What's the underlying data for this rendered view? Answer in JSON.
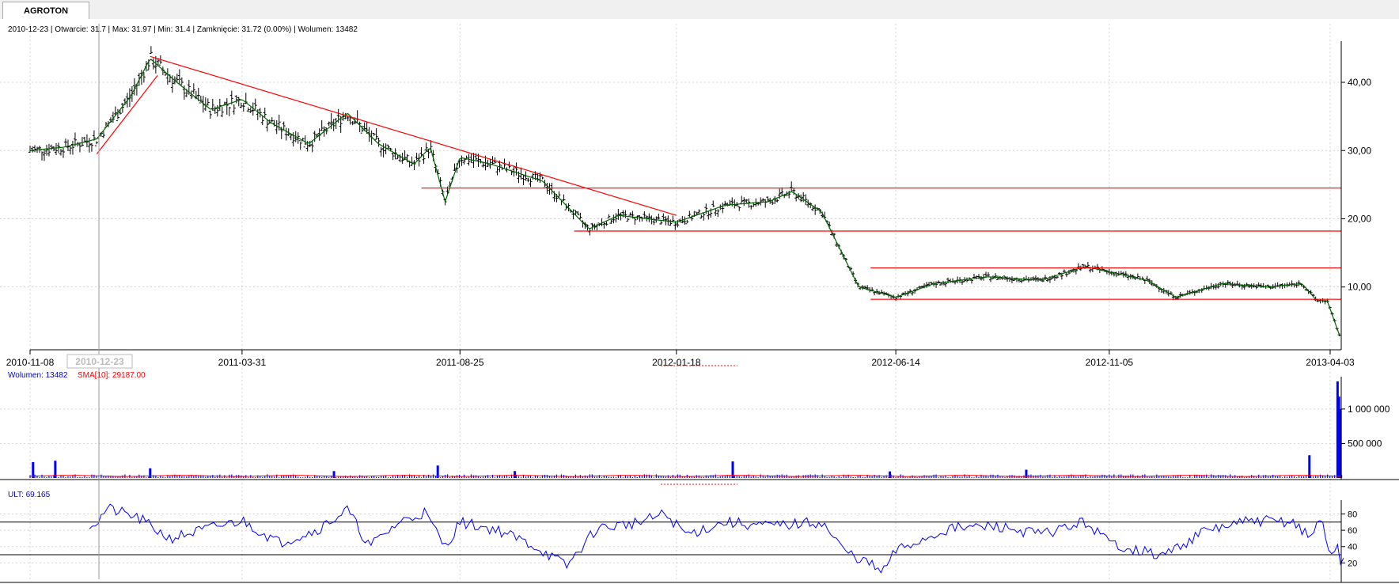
{
  "tab": {
    "label": "AGROTON"
  },
  "info_line": "2010-12-23 | Otwarcie: 31.7 | Max: 31.97 | Min: 31.4 | Zamknięcie: 31.72 (0.00%)  | Wolumen: 13482",
  "cursor_date": "2010-12-23",
  "volume_legend": {
    "wolumen": "Wolumen: 13482",
    "sma": "SMA[10]: 29187.00"
  },
  "ult_legend": "ULT: 69.165",
  "colors": {
    "price_bar": "#000000",
    "sma": "#006400",
    "trend": "#ff0000",
    "volume": "#0000ff",
    "volume_sma": "#ff0000",
    "ult": "#0000ff"
  },
  "chart_data": [
    {
      "type": "bar",
      "name": "price",
      "x_ticks": [
        "2010-11-08",
        "2011-03-31",
        "2011-08-25",
        "2012-01-18",
        "2012-06-14",
        "2012-11-05",
        "2013-04-03"
      ],
      "y_ticks": [
        "10,00",
        "20,00",
        "30,00",
        "40,00"
      ],
      "ylim": [
        0.8,
        46.5
      ],
      "grid": true,
      "close_path": [
        [
          "2010-11-08",
          30.0
        ],
        [
          "2010-12-01",
          30.5
        ],
        [
          "2010-12-23",
          31.7
        ],
        [
          "2011-01-15",
          38.0
        ],
        [
          "2011-01-28",
          43.5
        ],
        [
          "2011-02-15",
          40.0
        ],
        [
          "2011-03-10",
          36.0
        ],
        [
          "2011-03-31",
          37.5
        ],
        [
          "2011-04-20",
          34.0
        ],
        [
          "2011-05-15",
          31.0
        ],
        [
          "2011-06-10",
          35.5
        ],
        [
          "2011-07-01",
          31.0
        ],
        [
          "2011-07-25",
          28.0
        ],
        [
          "2011-08-05",
          30.5
        ],
        [
          "2011-08-15",
          22.5
        ],
        [
          "2011-08-25",
          29.0
        ],
        [
          "2011-09-15",
          28.0
        ],
        [
          "2011-10-20",
          25.5
        ],
        [
          "2011-11-20",
          18.5
        ],
        [
          "2011-12-10",
          20.5
        ],
        [
          "2012-01-18",
          19.5
        ],
        [
          "2012-02-20",
          22.0
        ],
        [
          "2012-03-20",
          22.5
        ],
        [
          "2012-04-05",
          24.0
        ],
        [
          "2012-04-25",
          21.0
        ],
        [
          "2012-05-20",
          10.0
        ],
        [
          "2012-06-14",
          8.5
        ],
        [
          "2012-07-10",
          10.5
        ],
        [
          "2012-08-15",
          11.5
        ],
        [
          "2012-09-20",
          11.0
        ],
        [
          "2012-10-20",
          13.0
        ],
        [
          "2012-11-30",
          11.0
        ],
        [
          "2012-12-20",
          8.5
        ],
        [
          "2013-01-20",
          10.5
        ],
        [
          "2013-02-20",
          10.0
        ],
        [
          "2013-03-15",
          10.5
        ],
        [
          "2013-03-25",
          8.0
        ],
        [
          "2013-04-01",
          8.0
        ],
        [
          "2013-04-10",
          2.5
        ]
      ],
      "trend_lines": [
        {
          "from": [
            "2010-12-23",
            29.5
          ],
          "to": [
            "2011-02-02",
            41.0
          ]
        },
        {
          "from": [
            "2011-01-28",
            43.8
          ],
          "to": [
            "2012-01-18",
            20.5
          ]
        },
        {
          "from": [
            "2011-07-30",
            24.5
          ],
          "to": [
            "2013-04-12",
            24.5
          ]
        },
        {
          "from": [
            "2011-11-10",
            18.2
          ],
          "to": [
            "2013-04-12",
            18.2
          ]
        },
        {
          "from": [
            "2012-05-28",
            12.8
          ],
          "to": [
            "2013-04-12",
            12.8
          ]
        },
        {
          "from": [
            "2012-05-28",
            8.2
          ],
          "to": [
            "2013-04-12",
            8.2
          ]
        }
      ]
    },
    {
      "type": "bar",
      "name": "volume",
      "series": [
        {
          "name": "Wolumen"
        },
        {
          "name": "SMA[10]"
        }
      ],
      "y_ticks": [
        "500 000",
        "1 000 000"
      ],
      "ylim": [
        0,
        1400000
      ],
      "spikes": [
        [
          "2010-11-10",
          230000
        ],
        [
          "2010-11-25",
          250000
        ],
        [
          "2011-01-28",
          140000
        ],
        [
          "2011-06-01",
          100000
        ],
        [
          "2011-08-10",
          180000
        ],
        [
          "2011-10-01",
          100000
        ],
        [
          "2012-02-25",
          240000
        ],
        [
          "2012-06-10",
          95000
        ],
        [
          "2012-09-10",
          120000
        ],
        [
          "2013-03-20",
          330000
        ],
        [
          "2013-04-08",
          1400000
        ],
        [
          "2013-04-09",
          1180000
        ],
        [
          "2013-04-10",
          1000000
        ]
      ]
    },
    {
      "type": "line",
      "name": "ULT",
      "series": [
        {
          "name": "ULT"
        }
      ],
      "y_ticks": [
        "20",
        "40",
        "60",
        "80"
      ],
      "ylim": [
        0,
        95
      ],
      "levels": [
        30,
        70
      ],
      "path": [
        [
          "2010-12-18",
          68
        ],
        [
          "2010-12-23",
          69
        ],
        [
          "2010-12-30",
          87
        ],
        [
          "2011-01-20",
          75
        ],
        [
          "2011-02-10",
          50
        ],
        [
          "2011-03-15",
          65
        ],
        [
          "2011-03-31",
          72
        ],
        [
          "2011-04-25",
          45
        ],
        [
          "2011-05-20",
          60
        ],
        [
          "2011-06-10",
          85
        ],
        [
          "2011-06-25",
          40
        ],
        [
          "2011-07-15",
          70
        ],
        [
          "2011-08-01",
          82
        ],
        [
          "2011-08-15",
          40
        ],
        [
          "2011-08-25",
          70
        ],
        [
          "2011-09-20",
          60
        ],
        [
          "2011-10-15",
          40
        ],
        [
          "2011-11-05",
          16
        ],
        [
          "2011-11-25",
          62
        ],
        [
          "2011-12-25",
          70
        ],
        [
          "2012-01-10",
          80
        ],
        [
          "2012-01-25",
          55
        ],
        [
          "2012-02-20",
          70
        ],
        [
          "2012-03-20",
          65
        ],
        [
          "2012-04-25",
          70
        ],
        [
          "2012-05-10",
          35
        ],
        [
          "2012-05-28",
          18
        ],
        [
          "2012-06-05",
          8
        ],
        [
          "2012-06-14",
          35
        ],
        [
          "2012-07-20",
          62
        ],
        [
          "2012-08-20",
          65
        ],
        [
          "2012-09-20",
          55
        ],
        [
          "2012-10-20",
          70
        ],
        [
          "2012-11-05",
          45
        ],
        [
          "2012-12-10",
          28
        ],
        [
          "2013-01-10",
          60
        ],
        [
          "2013-02-10",
          72
        ],
        [
          "2013-03-10",
          70
        ],
        [
          "2013-03-20",
          50
        ],
        [
          "2013-03-28",
          75
        ],
        [
          "2013-04-03",
          30
        ],
        [
          "2013-04-08",
          42
        ],
        [
          "2013-04-10",
          12
        ],
        [
          "2013-04-12",
          30
        ]
      ]
    }
  ]
}
